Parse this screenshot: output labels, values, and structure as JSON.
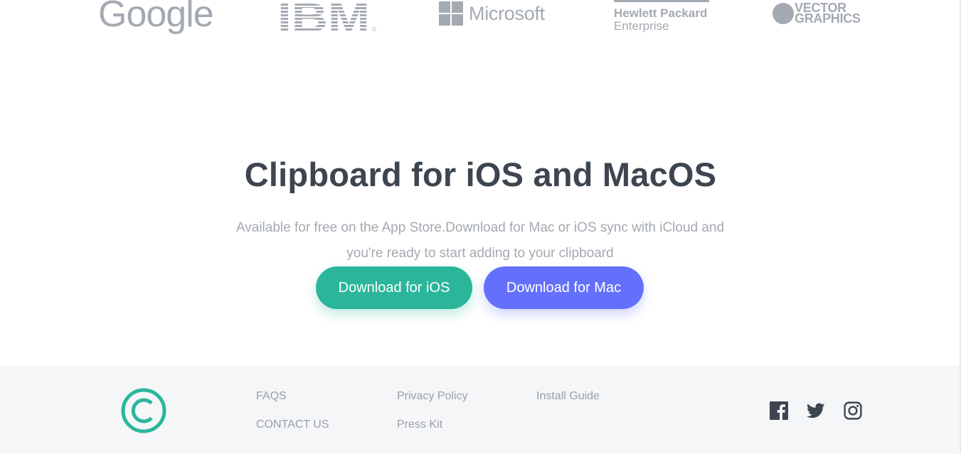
{
  "logos": {
    "google": "Google",
    "ibm": "IBM",
    "microsoft": "Microsoft",
    "hpe_line1": "Hewlett Packard",
    "hpe_line2": "Enterprise",
    "vector_line1": "VECTOR",
    "vector_line2": "GRAPHICS"
  },
  "hero": {
    "title": "Clipboard for iOS and MacOS",
    "description_line1": "Available for free on the App Store.Download for Mac or iOS sync with iCloud and",
    "description_line2": "you're ready to start adding to your clipboard",
    "ios_button": "Download for iOS",
    "mac_button": "Download for Mac"
  },
  "footer": {
    "links": {
      "faqs": "FAQS",
      "contact": "CONTACT US",
      "privacy": "Privacy Policy",
      "press": "Press Kit",
      "install": "Install Guide"
    },
    "social": [
      "facebook-icon",
      "twitter-icon",
      "instagram-icon"
    ]
  },
  "colors": {
    "accent_green": "#2bb69c",
    "accent_blue": "#6470fb",
    "logo_gray": "#a4aab2",
    "heading": "#3d4650",
    "footer_bg": "#f5f6f8"
  }
}
